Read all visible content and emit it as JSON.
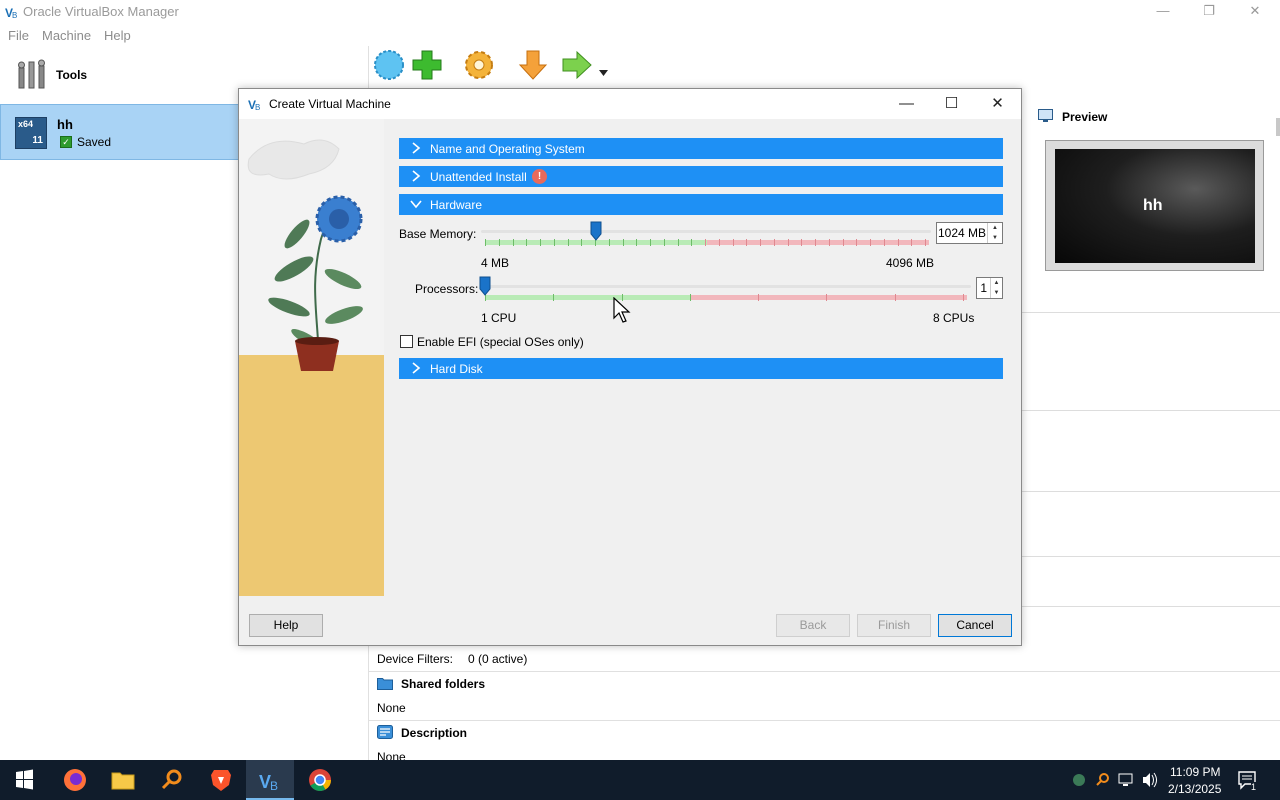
{
  "app": {
    "title": "Oracle VirtualBox Manager",
    "menu": [
      "File",
      "Machine",
      "Help"
    ],
    "tools_label": "Tools"
  },
  "vm_list": [
    {
      "name": "hh",
      "state": "Saved",
      "os_badge_top": "x64",
      "os_badge_bottom": "11"
    }
  ],
  "toolbar": {
    "items": [
      "New",
      "Add",
      "Settings",
      "Discard",
      "Start"
    ]
  },
  "preview": {
    "title": "Preview",
    "screen_text": "hh"
  },
  "details": {
    "device_filters_label": "Device Filters:",
    "device_filters_value": "0 (0 active)",
    "shared_folders_title": "Shared folders",
    "shared_folders_value": "None",
    "description_title": "Description",
    "description_value": "None"
  },
  "dialog": {
    "title": "Create Virtual Machine",
    "sections": [
      {
        "label": "Name and Operating System",
        "expanded": false
      },
      {
        "label": "Unattended Install",
        "expanded": false,
        "warning": true
      },
      {
        "label": "Hardware",
        "expanded": true
      },
      {
        "label": "Hard Disk",
        "expanded": false
      }
    ],
    "hardware": {
      "base_memory_label": "Base Memory:",
      "base_memory_value": "1024 MB",
      "base_memory_min": "4 MB",
      "base_memory_max": "4096 MB",
      "base_memory_fraction": 0.25,
      "processors_label": "Processors:",
      "processors_value": "1",
      "processors_min": "1 CPU",
      "processors_max": "8 CPUs",
      "processors_fraction": 0.0,
      "efi_label": "Enable EFI (special OSes only)",
      "efi_checked": false
    },
    "buttons": {
      "help": "Help",
      "back": "Back",
      "finish": "Finish",
      "cancel": "Cancel"
    }
  },
  "taskbar": {
    "apps": [
      "start",
      "firefox",
      "file-explorer",
      "search",
      "brave",
      "virtualbox",
      "chrome"
    ],
    "time": "11:09 PM",
    "date": "2/13/2025",
    "notification_count": "1"
  },
  "colors": {
    "section_blue": "#1e90f5",
    "selected_vm_bg": "#a9d3f5",
    "taskbar_bg": "#101c2b"
  }
}
